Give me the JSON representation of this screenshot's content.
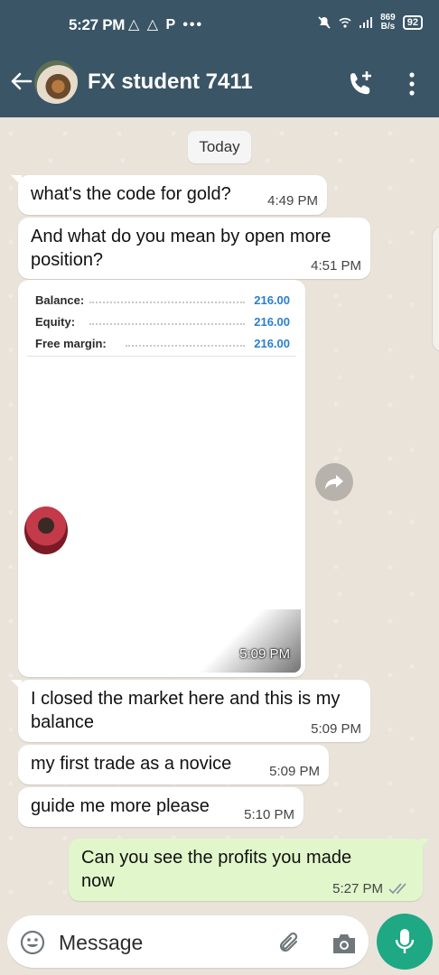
{
  "status_bar": {
    "time": "5:27 PM",
    "notification_icons": "△ △ P •••",
    "net_speed_value": "869",
    "net_speed_unit": "B/s",
    "battery": "92"
  },
  "header": {
    "contact_name": "FX student 7411"
  },
  "chat": {
    "date_chip": "Today",
    "messages": [
      {
        "text": "what's the code for gold?",
        "time": "4:49 PM"
      },
      {
        "text": "And what do you mean by open more position?",
        "time": "4:51 PM"
      },
      {
        "text": "I closed the market here and this is my balance",
        "time": "5:09 PM"
      },
      {
        "text": "my first trade as a novice",
        "time": "5:09 PM"
      },
      {
        "text": "guide me more please",
        "time": "5:10 PM"
      },
      {
        "text": "Can you see the profits you made now",
        "time": "5:27 PM"
      }
    ],
    "image_message": {
      "time": "5:09 PM",
      "rows": [
        {
          "label": "Balance:",
          "value": "216.00"
        },
        {
          "label": "Equity:",
          "value": "216.00"
        },
        {
          "label": "Free margin:",
          "value": "216.00"
        }
      ]
    }
  },
  "composer": {
    "placeholder": "Message"
  },
  "colors": {
    "header_bg": "#3a5566",
    "outgoing_bubble": "#e1f7cb",
    "mic_button": "#1ea884",
    "read_ticks": "#8a9aa3",
    "link_value": "#2a7fd0"
  }
}
